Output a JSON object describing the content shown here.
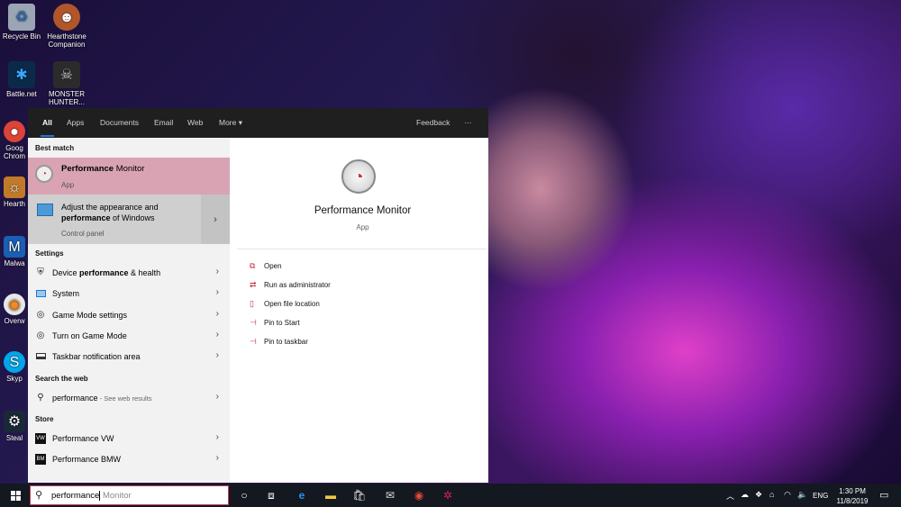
{
  "desktop": {
    "icons": [
      {
        "label": "Recycle Bin",
        "icon": "recycle-bin-icon"
      },
      {
        "label": "Hearthstone Companion",
        "icon": "hearthstone-icon"
      },
      {
        "label": "Battle.net",
        "icon": "battlenet-icon"
      },
      {
        "label": "MONSTER HUNTER...",
        "icon": "monster-hunter-icon"
      },
      {
        "label": "Goog Chrom",
        "icon": "chrome-icon"
      },
      {
        "label": "Hearth",
        "icon": "hearthstone-icon"
      },
      {
        "label": "Malwa",
        "icon": "malwarebytes-icon"
      },
      {
        "label": "Overw",
        "icon": "overwatch-icon"
      },
      {
        "label": "Skyp",
        "icon": "skype-icon"
      },
      {
        "label": "Steal",
        "icon": "steam-icon"
      }
    ]
  },
  "start_menu": {
    "tabs": [
      "All",
      "Apps",
      "Documents",
      "Email",
      "Web",
      "More"
    ],
    "active_tab": "All",
    "feedback_label": "Feedback",
    "ellipsis_label": "···",
    "best_match": {
      "heading": "Best match",
      "title_bold": "Performance",
      "title_rest": " Monitor",
      "subtitle": "App"
    },
    "adjust": {
      "line1": "Adjust the appearance and",
      "line2_bold": "performance",
      "line2_rest": " of Windows",
      "subtitle": "Control panel"
    },
    "settings": {
      "heading": "Settings",
      "items": [
        {
          "pre": "Device ",
          "bold": "performance",
          "post": " & health",
          "icon": "shield-icon"
        },
        {
          "pre": "System",
          "bold": "",
          "post": "",
          "icon": "laptop-icon"
        },
        {
          "pre": "Game Mode settings",
          "bold": "",
          "post": "",
          "icon": "game-mode-icon"
        },
        {
          "pre": "Turn on Game Mode",
          "bold": "",
          "post": "",
          "icon": "game-mode-icon"
        },
        {
          "pre": "Taskbar notification area",
          "bold": "",
          "post": "",
          "icon": "taskbar-icon"
        }
      ]
    },
    "web": {
      "heading": "Search the web",
      "query": "performance",
      "suffix": " - See web results"
    },
    "store": {
      "heading": "Store",
      "items": [
        "Performance VW",
        "Performance BMW"
      ]
    },
    "detail": {
      "title": "Performance Monitor",
      "subtitle": "App",
      "actions": [
        {
          "label": "Open",
          "icon": "open-icon"
        },
        {
          "label": "Run as administrator",
          "icon": "admin-icon"
        },
        {
          "label": "Open file location",
          "icon": "file-location-icon"
        },
        {
          "label": "Pin to Start",
          "icon": "pin-icon"
        },
        {
          "label": "Pin to taskbar",
          "icon": "pin-icon"
        }
      ]
    }
  },
  "taskbar": {
    "search_typed": "performance",
    "search_suggest": " Monitor",
    "lang": "ENG",
    "time": "1:30 PM",
    "date": "11/8/2019"
  }
}
